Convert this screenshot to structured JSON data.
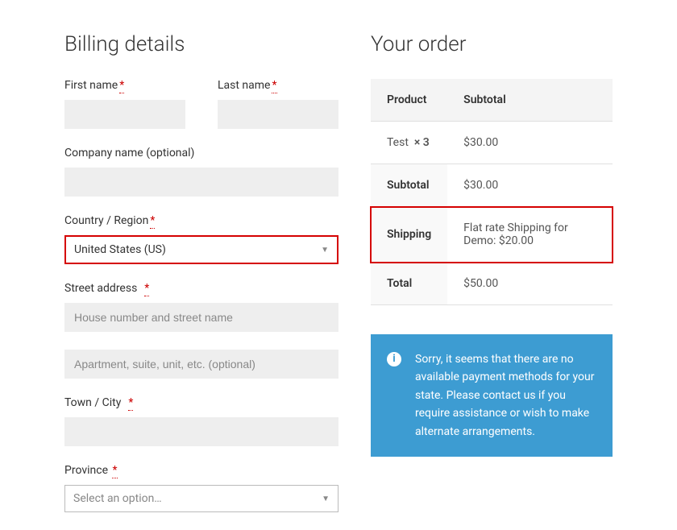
{
  "billing": {
    "heading": "Billing details",
    "first_name_label": "First name",
    "last_name_label": "Last name",
    "company_label": "Company name (optional)",
    "country_label": "Country / Region",
    "country_value": "United States (US)",
    "street_label": "Street address",
    "street1_placeholder": "House number and street name",
    "street2_placeholder": "Apartment, suite, unit, etc. (optional)",
    "city_label": "Town / City",
    "province_label": "Province",
    "province_placeholder": "Select an option…"
  },
  "order": {
    "heading": "Your order",
    "product_header": "Product",
    "subtotal_header": "Subtotal",
    "line_item_name": "Test",
    "line_item_qty": "× 3",
    "line_item_total": "$30.00",
    "subtotal_label": "Subtotal",
    "subtotal_value": "$30.00",
    "shipping_label": "Shipping",
    "shipping_value": "Flat rate Shipping for Demo: $20.00",
    "total_label": "Total",
    "total_value": "$50.00"
  },
  "notice": {
    "message": "Sorry, it seems that there are no available payment methods for your state. Please contact us if you require assistance or wish to make alternate arrangements."
  }
}
